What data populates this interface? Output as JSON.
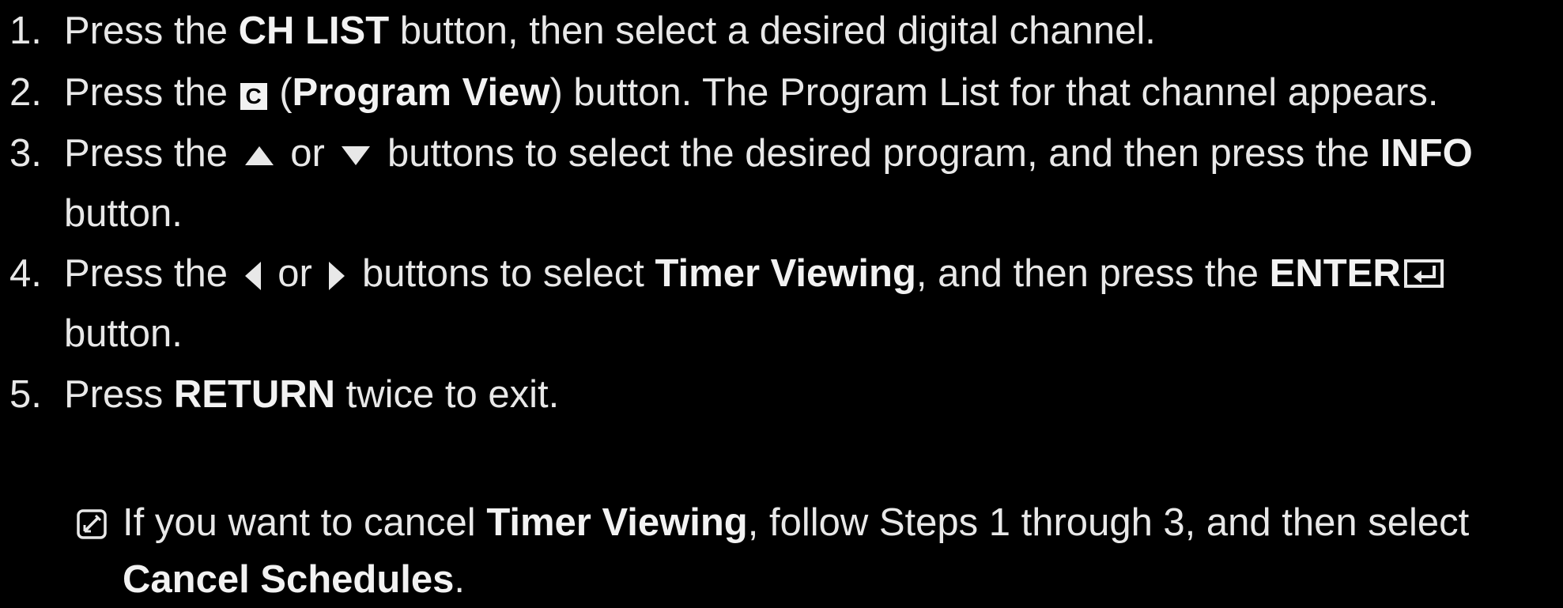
{
  "steps": [
    {
      "number": "1.",
      "parts": [
        "Press the ",
        "CH LIST",
        " button, then select a desired digital channel."
      ]
    },
    {
      "number": "2.",
      "button_letter": "C",
      "parts": [
        "Press the ",
        " (",
        "Program View",
        ") button. The Program List for that channel appears."
      ]
    },
    {
      "number": "3.",
      "parts": [
        "Press the ",
        " or ",
        " buttons to select the desired program, and then press the ",
        "INFO",
        "button."
      ]
    },
    {
      "number": "4.",
      "parts": [
        "Press the ",
        " or ",
        " buttons to select ",
        "Timer Viewing",
        ", and then press the ",
        "ENTER",
        "button."
      ]
    },
    {
      "number": "5.",
      "parts": [
        "Press ",
        "RETURN",
        " twice to exit."
      ]
    }
  ],
  "note": {
    "icon": "note-icon",
    "parts": [
      "If you want to cancel ",
      "Timer Viewing",
      ", follow Steps 1 through 3, and then select",
      "Cancel Schedules",
      "."
    ]
  },
  "icons": {
    "up": "up-arrow-icon",
    "down": "down-arrow-icon",
    "left": "left-arrow-icon",
    "right": "right-arrow-icon",
    "enter": "enter-icon",
    "c_button": "c-button-icon"
  },
  "colors": {
    "background": "#000000",
    "text": "#e8e8e8"
  }
}
